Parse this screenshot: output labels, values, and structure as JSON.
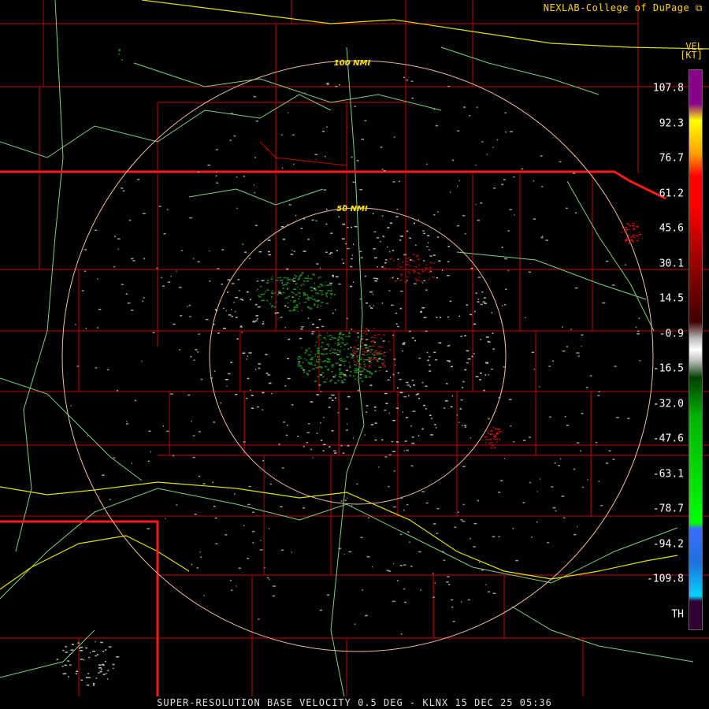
{
  "credit": "NEXLAB-College of DuPage",
  "credit_icon": "external-link-icon",
  "legend": {
    "product": "VEL",
    "units": "[KT]",
    "ticks": [
      "107.8",
      "92.3",
      "76.7",
      "61.2",
      "45.6",
      "30.1",
      "14.5",
      "-0.9",
      "-16.5",
      "-32.0",
      "-47.6",
      "-63.1",
      "-78.7",
      "-94.2",
      "-109.8",
      "TH"
    ],
    "colors": {
      "purple": "#8a0088",
      "yellow": "#ffff00",
      "red": "#ff0000",
      "darkred": "#7a0000",
      "gray": "#bdbdbd",
      "green": "#00b400",
      "blue": "#3a6cff",
      "cyan": "#00d4ff"
    }
  },
  "range_rings": [
    {
      "label": "100 NMI"
    },
    {
      "label": "50 NMI"
    }
  ],
  "footer": "SUPER-RESOLUTION BASE VELOCITY 0.5 DEG - KLNX 15 DEC 25 05:36",
  "map_colors": {
    "county": "#c80000",
    "state": "#ff1a1a",
    "river": "#7fd07f",
    "highway": "#e0e000",
    "ring": "#f0c0a0"
  }
}
